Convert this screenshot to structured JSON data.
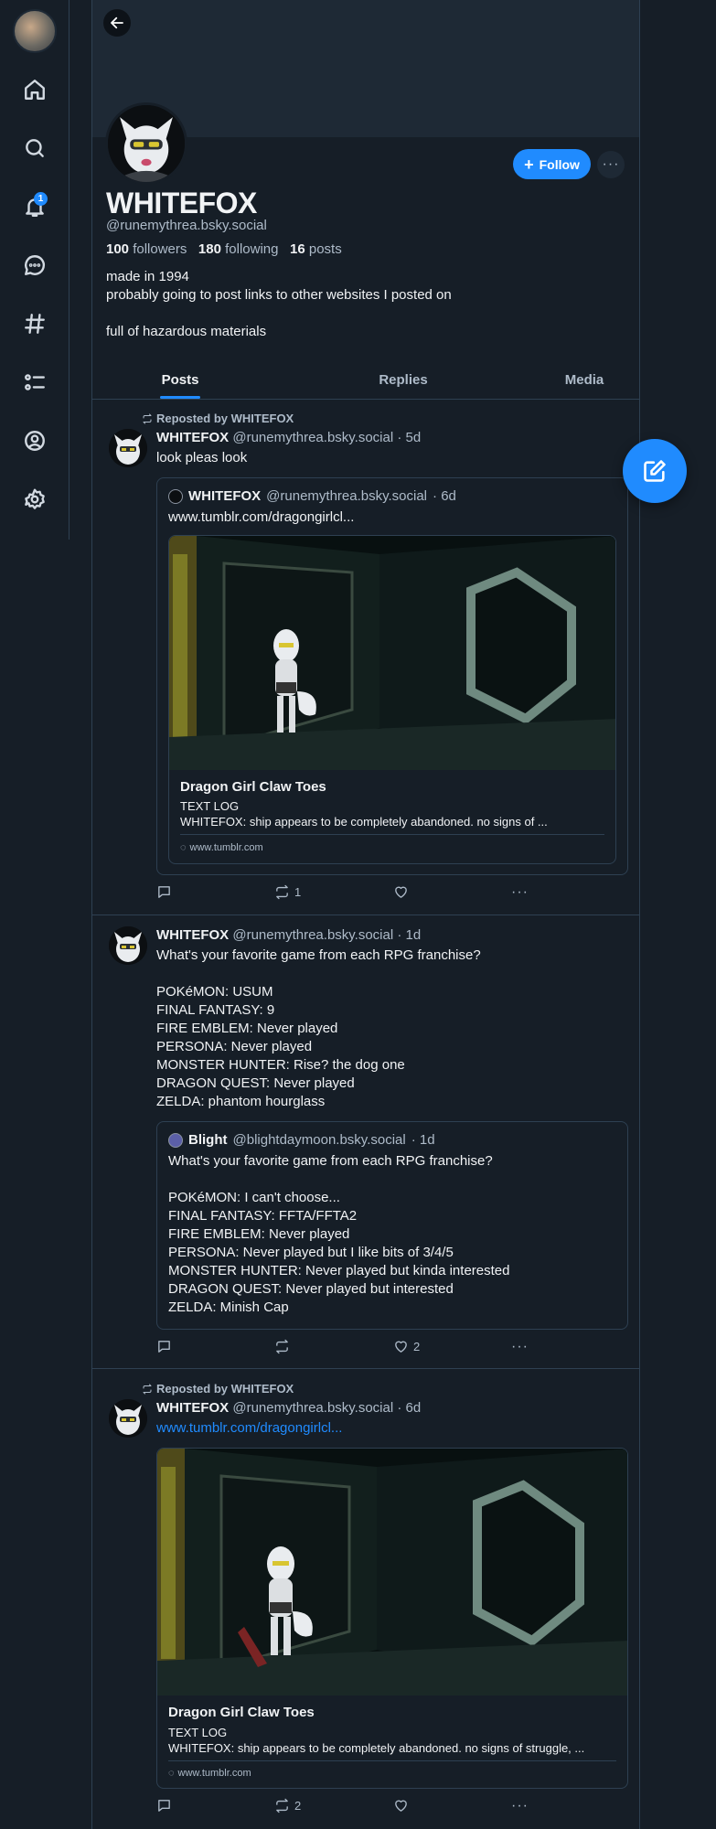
{
  "nav": {
    "items": [
      "home-icon",
      "search-icon",
      "notifications-icon",
      "chat-icon",
      "feeds-icon",
      "lists-icon",
      "profile-icon",
      "settings-icon"
    ],
    "notification_count": "1"
  },
  "profile": {
    "display_name": "WHITEFOX",
    "handle": "@runemythrea.bsky.social",
    "followers_count": "100",
    "followers_label": "followers",
    "following_count": "180",
    "following_label": "following",
    "posts_count": "16",
    "posts_label": "posts",
    "bio": "made in 1994\nprobably going to post links to other websites I posted on\n\nfull of hazardous materials",
    "follow_label": "Follow",
    "more_label": "···"
  },
  "tabs": [
    "Posts",
    "Replies",
    "Media"
  ],
  "colors": {
    "accent": "#208bfe",
    "background": "#161e27",
    "border": "#2e4052"
  },
  "posts": [
    {
      "repost_label": "Reposted by WHITEFOX",
      "author": "WHITEFOX",
      "handle": "@runemythrea.bsky.social",
      "time": "· 5d",
      "text": "look pleas look",
      "quote": {
        "author": "WHITEFOX",
        "handle": "@runemythrea.bsky.social",
        "time": "· 6d",
        "text": "www.tumblr.com/dragongirlcl...",
        "card": {
          "title": "Dragon Girl Claw Toes",
          "desc": "TEXT LOG\nWHITEFOX: ship appears to be completely abandoned. no signs of ...",
          "domain": "www.tumblr.com"
        }
      },
      "replies": "",
      "reposts": "1",
      "likes": ""
    },
    {
      "author": "WHITEFOX",
      "handle": "@runemythrea.bsky.social",
      "time": "· 1d",
      "text": "What's your favorite game from each RPG franchise?\n\nPOKéMON: USUM\nFINAL FANTASY: 9\nFIRE EMBLEM: Never played\nPERSONA: Never played\nMONSTER HUNTER: Rise? the dog one\nDRAGON QUEST: Never played\nZELDA: phantom hourglass",
      "quote": {
        "author": "Blight",
        "handle": "@blightdaymoon.bsky.social",
        "time": "· 1d",
        "text": "What's your favorite game from each RPG franchise?\n\nPOKéMON: I can't choose...\nFINAL FANTASY: FFTA/FFTA2\nFIRE EMBLEM: Never played\nPERSONA: Never played but I like bits of 3/4/5\nMONSTER HUNTER: Never played but kinda interested\nDRAGON QUEST: Never played but interested\nZELDA: Minish Cap"
      },
      "replies": "",
      "reposts": "",
      "likes": "2"
    },
    {
      "repost_label": "Reposted by WHITEFOX",
      "author": "WHITEFOX",
      "handle": "@runemythrea.bsky.social",
      "time": "· 6d",
      "text": "www.tumblr.com/dragongirlcl...",
      "card": {
        "title": "Dragon Girl Claw Toes",
        "desc": "TEXT LOG\nWHITEFOX: ship appears to be completely abandoned. no signs of struggle, ...",
        "domain": "www.tumblr.com"
      },
      "replies": "",
      "reposts": "2",
      "likes": ""
    }
  ]
}
